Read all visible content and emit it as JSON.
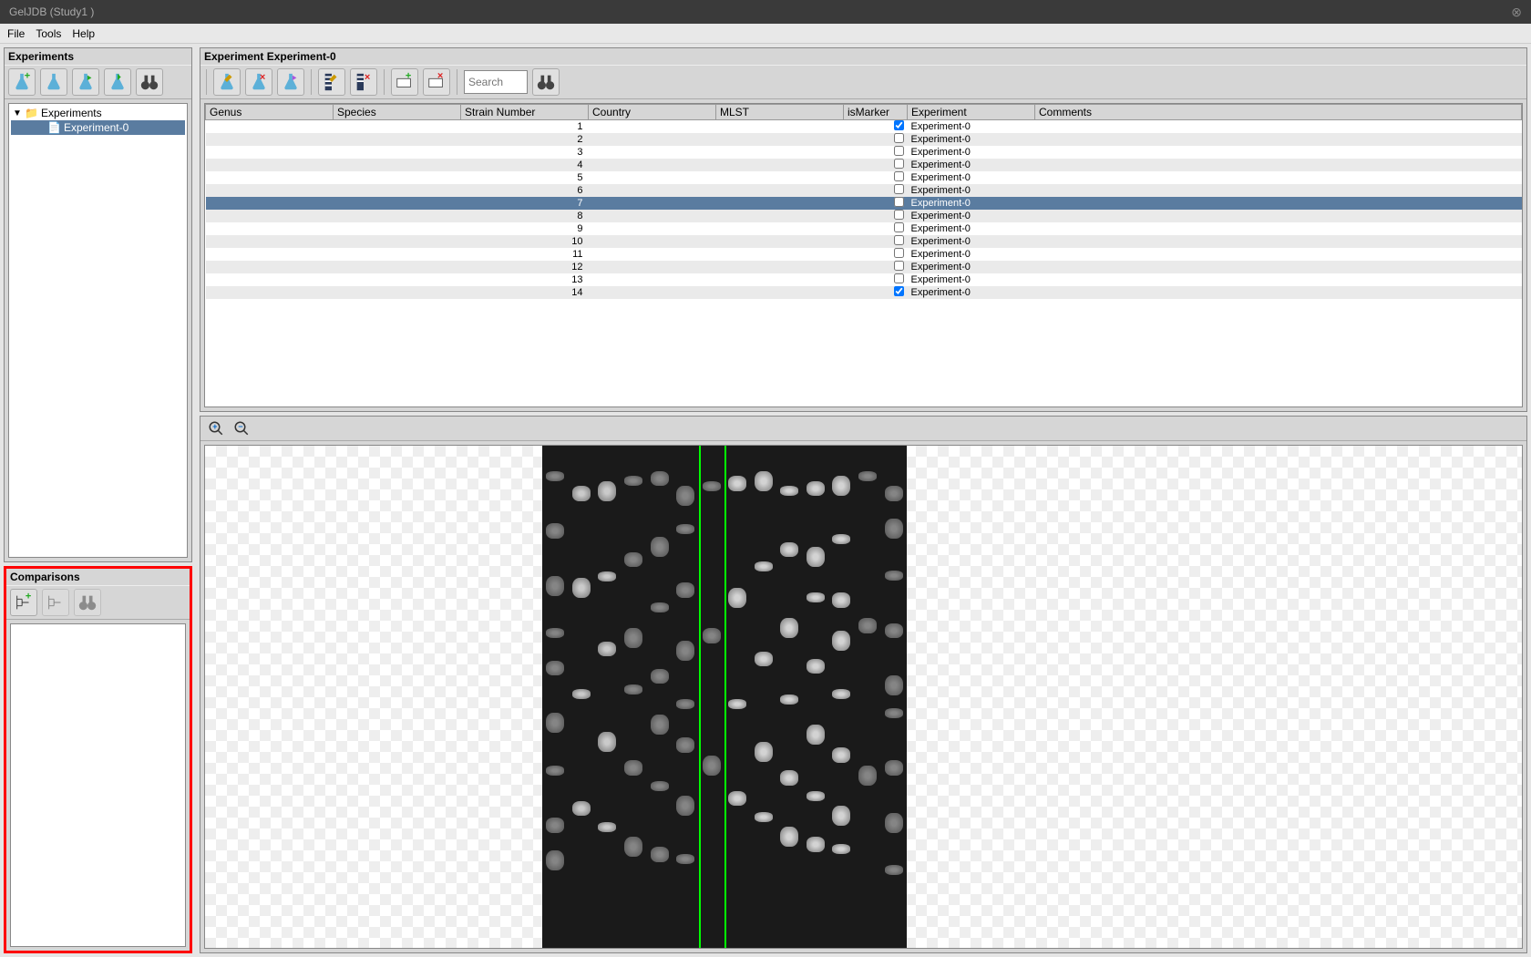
{
  "window": {
    "title": "GelJDB (Study1 )"
  },
  "menubar": {
    "file": "File",
    "tools": "Tools",
    "help": "Help"
  },
  "experiments_panel": {
    "title": "Experiments",
    "tree": {
      "root": {
        "label": "Experiments",
        "expanded": true
      },
      "child": {
        "label": "Experiment-0",
        "selected": true
      }
    }
  },
  "comparisons_panel": {
    "title": "Comparisons"
  },
  "experiment_panel": {
    "title": "Experiment Experiment-0",
    "search_placeholder": "Search",
    "columns": {
      "genus": "Genus",
      "species": "Species",
      "strain": "Strain Number",
      "country": "Country",
      "mlst": "MLST",
      "ismarker": "isMarker",
      "experiment": "Experiment",
      "comments": "Comments"
    },
    "rows": [
      {
        "strain": "1",
        "ismarker": true,
        "experiment": "Experiment-0",
        "selected": false
      },
      {
        "strain": "2",
        "ismarker": false,
        "experiment": "Experiment-0",
        "selected": false
      },
      {
        "strain": "3",
        "ismarker": false,
        "experiment": "Experiment-0",
        "selected": false
      },
      {
        "strain": "4",
        "ismarker": false,
        "experiment": "Experiment-0",
        "selected": false
      },
      {
        "strain": "5",
        "ismarker": false,
        "experiment": "Experiment-0",
        "selected": false
      },
      {
        "strain": "6",
        "ismarker": false,
        "experiment": "Experiment-0",
        "selected": false
      },
      {
        "strain": "7",
        "ismarker": false,
        "experiment": "Experiment-0",
        "selected": true
      },
      {
        "strain": "8",
        "ismarker": false,
        "experiment": "Experiment-0",
        "selected": false
      },
      {
        "strain": "9",
        "ismarker": false,
        "experiment": "Experiment-0",
        "selected": false
      },
      {
        "strain": "10",
        "ismarker": false,
        "experiment": "Experiment-0",
        "selected": false
      },
      {
        "strain": "11",
        "ismarker": false,
        "experiment": "Experiment-0",
        "selected": false
      },
      {
        "strain": "12",
        "ismarker": false,
        "experiment": "Experiment-0",
        "selected": false
      },
      {
        "strain": "13",
        "ismarker": false,
        "experiment": "Experiment-0",
        "selected": false
      },
      {
        "strain": "14",
        "ismarker": true,
        "experiment": "Experiment-0",
        "selected": false
      }
    ]
  },
  "icons": {
    "flask_add": "flask-add-icon",
    "flask": "flask-icon",
    "flask_run": "flask-run-icon",
    "flask_export": "flask-export-icon",
    "binoculars": "binoculars-icon",
    "flask_edit": "flask-edit-icon",
    "flask_delete": "flask-delete-icon",
    "flask_dup": "flask-dup-icon",
    "bands_edit": "bands-edit-icon",
    "bands_delete": "bands-delete-icon",
    "tag_add": "tag-add-icon",
    "tag_delete": "tag-delete-icon",
    "tree_add": "tree-add-icon",
    "tree_dup": "tree-dup-icon",
    "zoom_in": "zoom-in-icon",
    "zoom_out": "zoom-out-icon"
  }
}
